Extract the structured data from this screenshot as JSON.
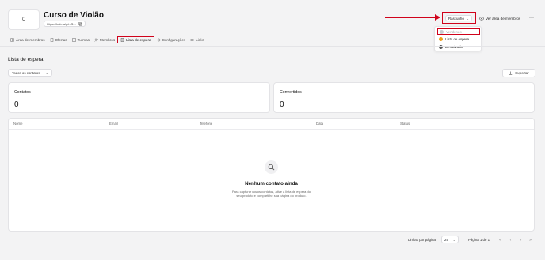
{
  "course": {
    "logo_letter": "C",
    "title": "Curso de Violão",
    "url": "https://hub.la/g/mS..."
  },
  "header": {
    "status_label": "Rascunho",
    "view_members_label": "Ver área de membros",
    "more_label": "···"
  },
  "status_menu": {
    "items": [
      {
        "label": "Vendendo",
        "color": "#9aa0a6"
      },
      {
        "label": "Lista de espera",
        "color": "#f0a020"
      },
      {
        "label": "Desativado",
        "color": "#555555"
      }
    ]
  },
  "tabs": [
    {
      "label": "Área de membros",
      "icon": "book-icon"
    },
    {
      "label": "Ofertas",
      "icon": "document-icon"
    },
    {
      "label": "Turmas",
      "icon": "columns-icon"
    },
    {
      "label": "Membros",
      "icon": "users-icon"
    },
    {
      "label": "Lista de espera",
      "icon": "list-icon",
      "active": true
    },
    {
      "label": "Configurações",
      "icon": "gear-icon"
    },
    {
      "label": "Links",
      "icon": "link-icon"
    }
  ],
  "main": {
    "section_title": "Lista de espera",
    "filter_value": "Todos os contatos",
    "export_label": "Exportar"
  },
  "stats": {
    "contacts_label": "Contatos",
    "contacts_value": "0",
    "converted_label": "Convertidos",
    "converted_value": "0"
  },
  "table": {
    "columns": [
      "Nome",
      "Email",
      "Telefone",
      "Data",
      "Status"
    ],
    "empty_title": "Nenhum contato ainda",
    "empty_desc": "Para capturar novos contatos, ative a lista de espera do seu produto e compartilhe sua página do produto."
  },
  "pagination": {
    "rows_label": "Linhas por página",
    "rows_value": "25",
    "page_info": "Página 1 de 1"
  },
  "colors": {
    "annotation_red": "#d0021b",
    "background": "#f3f3f4"
  }
}
